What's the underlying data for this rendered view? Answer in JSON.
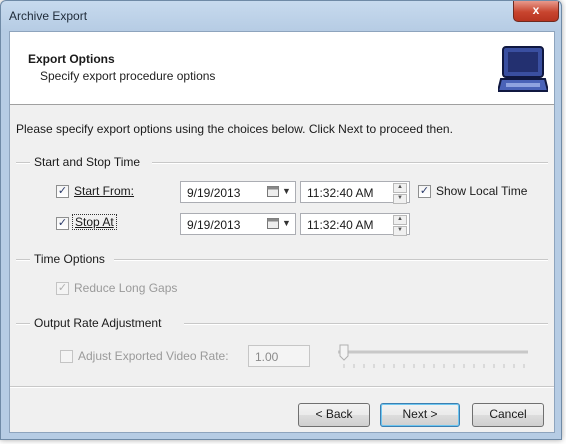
{
  "window": {
    "title": "Archive Export",
    "close_glyph": "x"
  },
  "header": {
    "title": "Export Options",
    "subtitle": "Specify export procedure options",
    "icon": "laptop-icon"
  },
  "intro": "Please specify export options using the choices below. Click Next to proceed then.",
  "start_stop": {
    "group_label": "Start and Stop Time",
    "start": {
      "label": "Start From:",
      "checked": true,
      "date": "9/19/2013",
      "time": "11:32:40 AM"
    },
    "stop": {
      "label": "Stop At",
      "checked": true,
      "date": "9/19/2013",
      "time": "11:32:40 AM"
    },
    "show_local_time": {
      "label": "Show Local Time",
      "checked": true
    }
  },
  "time_options": {
    "group_label": "Time Options",
    "reduce_long_gaps": {
      "label": "Reduce Long Gaps",
      "checked": true,
      "enabled": false
    }
  },
  "output_rate": {
    "group_label": "Output Rate Adjustment",
    "adjust": {
      "label": "Adjust Exported Video Rate:",
      "checked": false,
      "enabled": false
    },
    "rate_value": "1.00",
    "slider_position": 0
  },
  "buttons": {
    "back": "< Back",
    "next": "Next >",
    "cancel": "Cancel"
  }
}
